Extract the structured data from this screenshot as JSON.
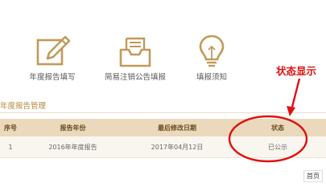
{
  "tiles": [
    {
      "label": "年度报告填写",
      "icon": "pencil-document-icon"
    },
    {
      "label": "简易注销公告填报",
      "icon": "inbox-tray-icon"
    },
    {
      "label": "填报须知",
      "icon": "lightbulb-icon"
    }
  ],
  "section_title": "年度报告管理",
  "annotation": "状态显示",
  "table": {
    "headers": [
      "序号",
      "报告年份",
      "最后修改日期",
      "状态"
    ],
    "rows": [
      [
        "1",
        "2016年年度报告",
        "2017年04月12日",
        "已公示"
      ]
    ]
  },
  "pager": {
    "first": "首页"
  },
  "colors": {
    "accent": "#b68a3c",
    "header_bg": "#ead9bc",
    "annotation": "#e11010"
  }
}
